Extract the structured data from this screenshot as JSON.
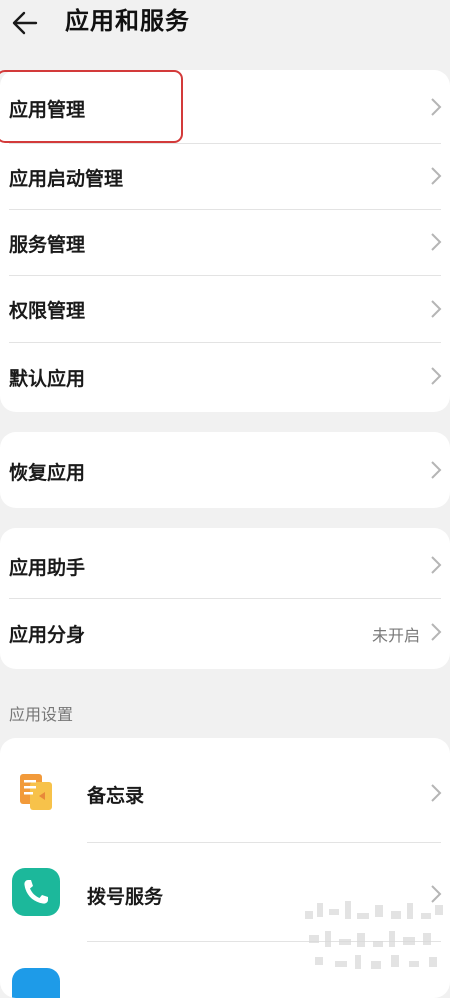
{
  "header": {
    "title": "应用和服务"
  },
  "group1": {
    "items": [
      {
        "label": "应用管理"
      },
      {
        "label": "应用启动管理"
      },
      {
        "label": "服务管理"
      },
      {
        "label": "权限管理"
      },
      {
        "label": "默认应用"
      }
    ]
  },
  "group2": {
    "items": [
      {
        "label": "恢复应用"
      }
    ]
  },
  "group3": {
    "items": [
      {
        "label": "应用助手"
      },
      {
        "label": "应用分身",
        "status": "未开启"
      }
    ]
  },
  "app_settings": {
    "section_title": "应用设置",
    "items": [
      {
        "label": "备忘录",
        "icon": "notepad-icon",
        "color": "#f29a3a"
      },
      {
        "label": "拨号服务",
        "icon": "phone-icon",
        "color": "#1cb89b"
      },
      {
        "label": "",
        "icon": "app-icon",
        "color": "#1e9be8"
      }
    ]
  },
  "colors": {
    "background": "#f1f1f1",
    "card": "#ffffff",
    "highlight": "#d33a3a"
  }
}
